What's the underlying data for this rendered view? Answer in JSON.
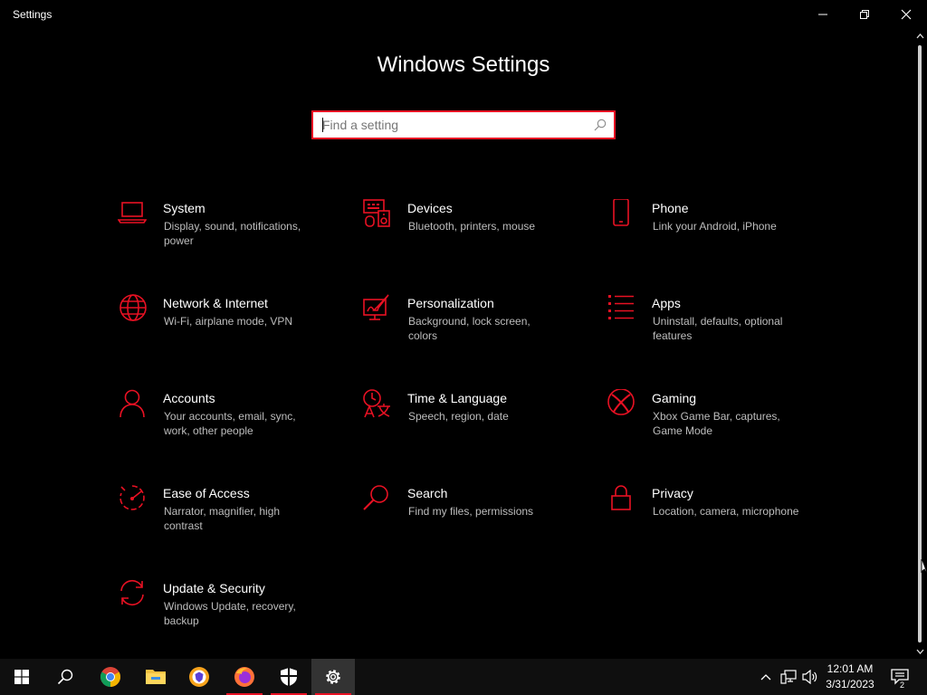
{
  "window": {
    "title": "Settings"
  },
  "heading": "Windows Settings",
  "search": {
    "placeholder": "Find a setting",
    "value": ""
  },
  "accent_color": "#e81123",
  "tiles": [
    {
      "icon": "laptop-icon",
      "name": "System",
      "desc": "Display, sound, notifications, power"
    },
    {
      "icon": "devices-icon",
      "name": "Devices",
      "desc": "Bluetooth, printers, mouse"
    },
    {
      "icon": "phone-icon",
      "name": "Phone",
      "desc": "Link your Android, iPhone"
    },
    {
      "icon": "globe-icon",
      "name": "Network & Internet",
      "desc": "Wi-Fi, airplane mode, VPN"
    },
    {
      "icon": "personalization-icon",
      "name": "Personalization",
      "desc": "Background, lock screen, colors"
    },
    {
      "icon": "apps-list-icon",
      "name": "Apps",
      "desc": "Uninstall, defaults, optional features"
    },
    {
      "icon": "person-icon",
      "name": "Accounts",
      "desc": "Your accounts, email, sync, work, other people"
    },
    {
      "icon": "time-language-icon",
      "name": "Time & Language",
      "desc": "Speech, region, date"
    },
    {
      "icon": "xbox-icon",
      "name": "Gaming",
      "desc": "Xbox Game Bar, captures, Game Mode"
    },
    {
      "icon": "ease-of-access-icon",
      "name": "Ease of Access",
      "desc": "Narrator, magnifier, high contrast"
    },
    {
      "icon": "magnifier-icon",
      "name": "Search",
      "desc": "Find my files, permissions"
    },
    {
      "icon": "lock-icon",
      "name": "Privacy",
      "desc": "Location, camera, microphone"
    },
    {
      "icon": "update-sync-icon",
      "name": "Update & Security",
      "desc": "Windows Update, recovery, backup"
    }
  ],
  "taskbar": {
    "apps": [
      "start-icon",
      "search-icon",
      "chrome-icon",
      "file-explorer-icon",
      "brave-icon",
      "firefox-icon",
      "security-shield-icon",
      "settings-gear-icon"
    ],
    "time": "12:01 AM",
    "date": "3/31/2023",
    "notification_count": "2"
  }
}
